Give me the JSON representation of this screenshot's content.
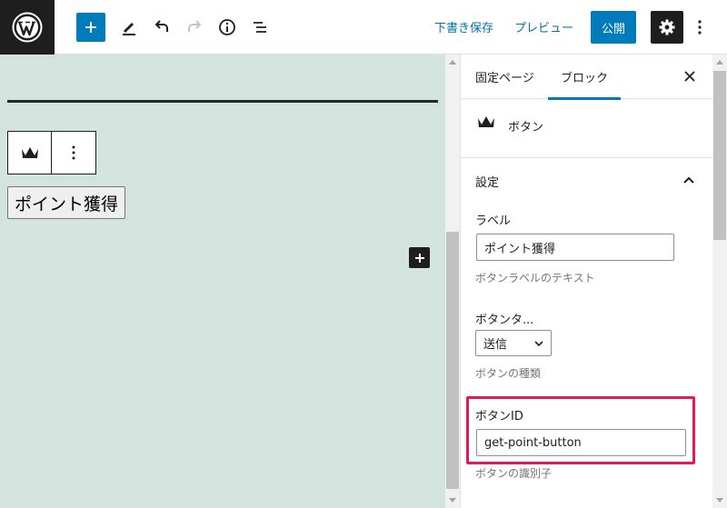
{
  "toolbar": {
    "save_draft_label": "下書き保存",
    "preview_label": "プレビュー",
    "publish_label": "公開"
  },
  "canvas": {
    "button_label": "ポイント獲得"
  },
  "sidebar": {
    "tabs": [
      {
        "label": "固定ページ"
      },
      {
        "label": "ブロック"
      }
    ],
    "block_card": {
      "title": "ボタン"
    },
    "panel": {
      "title": "設定",
      "label_field": {
        "label": "ラベル",
        "value": "ポイント獲得",
        "help": "ボタンラベルのテキスト"
      },
      "type_field": {
        "label": "ボタンタ...",
        "selected": "送信",
        "help": "ボタンの種類"
      },
      "id_field": {
        "label": "ボタンID",
        "value": "get-point-button",
        "help": "ボタンの識別子"
      }
    }
  },
  "colors": {
    "accent": "#007cba",
    "canvas_bg": "#d3e4df",
    "highlight": "#e8175d",
    "dark": "#1e1e1e"
  }
}
